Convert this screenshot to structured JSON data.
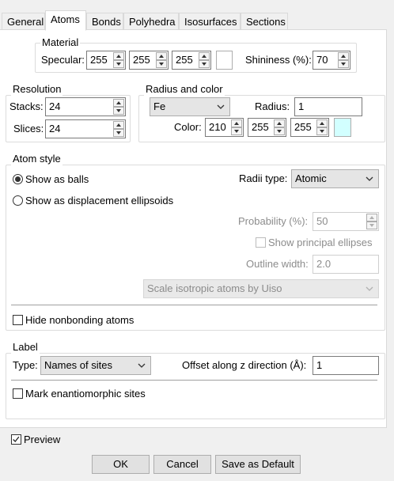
{
  "tabs": [
    "General",
    "Atoms",
    "Bonds",
    "Polyhedra",
    "Isosurfaces",
    "Sections"
  ],
  "material": {
    "title": "Material",
    "specular_label": "Specular:",
    "specular": [
      "255",
      "255",
      "255"
    ],
    "specular_swatch": "#ffffff",
    "shininess_label": "Shininess (%):",
    "shininess": "70"
  },
  "resolution": {
    "title": "Resolution",
    "stacks_label": "Stacks:",
    "stacks": "24",
    "slices_label": "Slices:",
    "slices": "24"
  },
  "radius_color": {
    "title": "Radius and color",
    "element": "Fe",
    "radius_label": "Radius:",
    "radius": "1",
    "color_label": "Color:",
    "color": [
      "210",
      "255",
      "255"
    ],
    "color_swatch": "#d2ffff"
  },
  "atom_style": {
    "title": "Atom style",
    "show_balls": "Show as balls",
    "show_ellipsoids": "Show as displacement ellipsoids",
    "selected": "balls",
    "radii_type_label": "Radii type:",
    "radii_type": "Atomic",
    "probability_label": "Probability (%):",
    "probability": "50",
    "principal_ellipses": "Show principal ellipses",
    "outline_width_label": "Outline width:",
    "outline_width": "2.0",
    "scale_option": "Scale isotropic atoms by Uiso",
    "hide_nonbonding": "Hide nonbonding atoms"
  },
  "label": {
    "title": "Label",
    "type_label": "Type:",
    "type": "Names of sites",
    "offset_label": "Offset along z direction (Å):",
    "offset": "1",
    "mark_enantiomorphic": "Mark enantiomorphic sites"
  },
  "preview_label": "Preview",
  "preview_checked": true,
  "buttons": {
    "ok": "OK",
    "cancel": "Cancel",
    "save_default": "Save as Default"
  }
}
